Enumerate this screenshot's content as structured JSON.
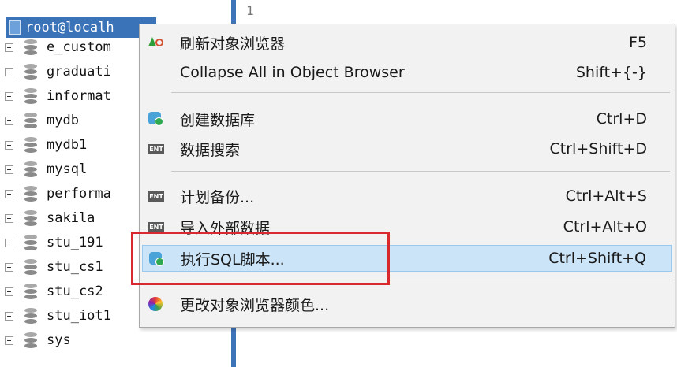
{
  "tree": {
    "root_label": "root@localh",
    "items": [
      {
        "label": "e_custom"
      },
      {
        "label": "graduati"
      },
      {
        "label": "informat"
      },
      {
        "label": "mydb"
      },
      {
        "label": "mydb1"
      },
      {
        "label": "mysql"
      },
      {
        "label": "performa"
      },
      {
        "label": "sakila"
      },
      {
        "label": "stu_191"
      },
      {
        "label": "stu_cs1"
      },
      {
        "label": "stu_cs2"
      },
      {
        "label": "stu_iot1"
      },
      {
        "label": "sys"
      }
    ]
  },
  "editor": {
    "line_number": "1"
  },
  "menu": {
    "items": [
      {
        "icon": "refresh-icon",
        "label": "刷新对象浏览器",
        "shortcut": "F5"
      },
      {
        "icon": "",
        "label": "Collapse All in Object Browser",
        "shortcut": "Shift+{-}"
      },
      {
        "icon": "create-database-icon",
        "label": "创建数据库",
        "shortcut": "Ctrl+D"
      },
      {
        "icon": "ent-icon",
        "label": "数据搜索",
        "shortcut": "Ctrl+Shift+D"
      },
      {
        "icon": "ent-icon",
        "label": "计划备份...",
        "shortcut": "Ctrl+Alt+S"
      },
      {
        "icon": "ent-icon",
        "label": "导入外部数据",
        "shortcut": "Ctrl+Alt+O"
      },
      {
        "icon": "execute-sql-icon",
        "label": "执行SQL脚本...",
        "shortcut": "Ctrl+Shift+Q",
        "highlighted": true
      },
      {
        "icon": "color-wheel-icon",
        "label": "更改对象浏览器颜色...",
        "shortcut": ""
      }
    ],
    "ent_badge": "ENT"
  },
  "colors": {
    "selection": "#3b73b9",
    "menu_highlight": "#cce4f7",
    "annotation": "#d8292f"
  }
}
